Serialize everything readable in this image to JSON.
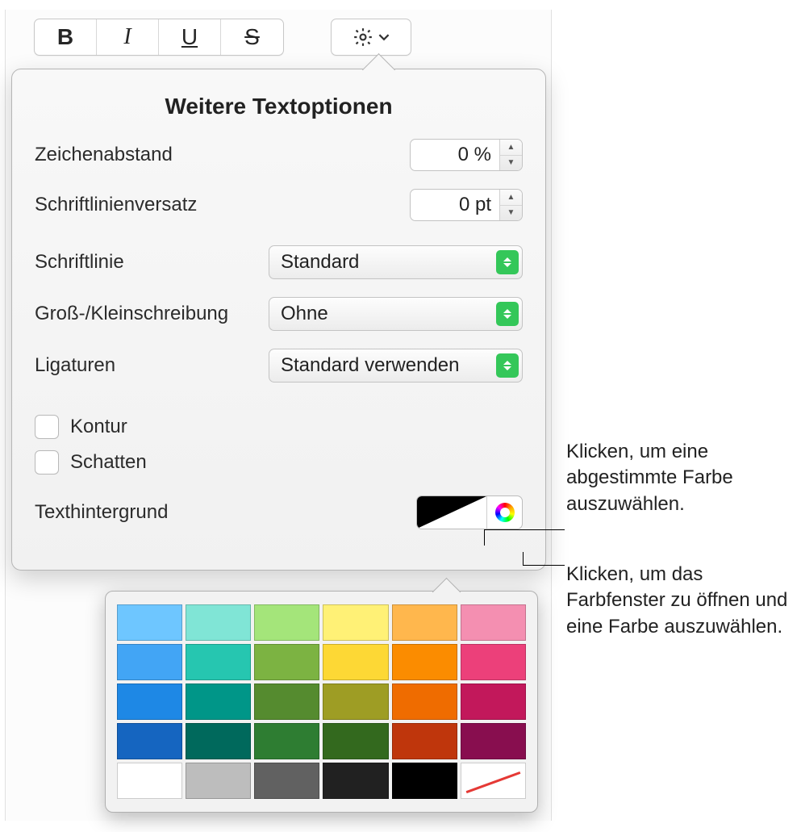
{
  "toolbar": {
    "bold": "B",
    "italic": "I",
    "underline": "U",
    "strike": "S"
  },
  "popover": {
    "title": "Weitere Textoptionen",
    "charSpacing": {
      "label": "Zeichenabstand",
      "value": "0 %"
    },
    "baseline": {
      "label": "Schriftlinienversatz",
      "value": "0 pt"
    },
    "schriftlinie": {
      "label": "Schriftlinie",
      "value": "Standard"
    },
    "case": {
      "label": "Groß-/Kleinschreibung",
      "value": "Ohne"
    },
    "ligatures": {
      "label": "Ligaturen",
      "value": "Standard verwenden"
    },
    "outline": "Kontur",
    "shadow": "Schatten",
    "textBg": "Texthintergrund"
  },
  "palette": [
    [
      "#6ec6ff",
      "#80e5d6",
      "#a4e57a",
      "#fff176",
      "#ffb74d",
      "#f48fb1"
    ],
    [
      "#42a5f5",
      "#26c6b0",
      "#7cb342",
      "#fdd835",
      "#fb8c00",
      "#ec407a"
    ],
    [
      "#1e88e5",
      "#009688",
      "#558b2f",
      "#9e9d24",
      "#ef6c00",
      "#c2185b"
    ],
    [
      "#1565c0",
      "#00695c",
      "#2e7d32",
      "#33691e",
      "#bf360c",
      "#880e4f"
    ],
    [
      "#ffffff",
      "#bdbdbd",
      "#616161",
      "#212121",
      "#000000",
      "none"
    ]
  ],
  "callouts": {
    "preset": "Klicken, um eine abgestimmte Farbe auszuwählen.",
    "wheel": "Klicken, um das Farbfenster zu öffnen und eine Farbe auszuwählen."
  }
}
